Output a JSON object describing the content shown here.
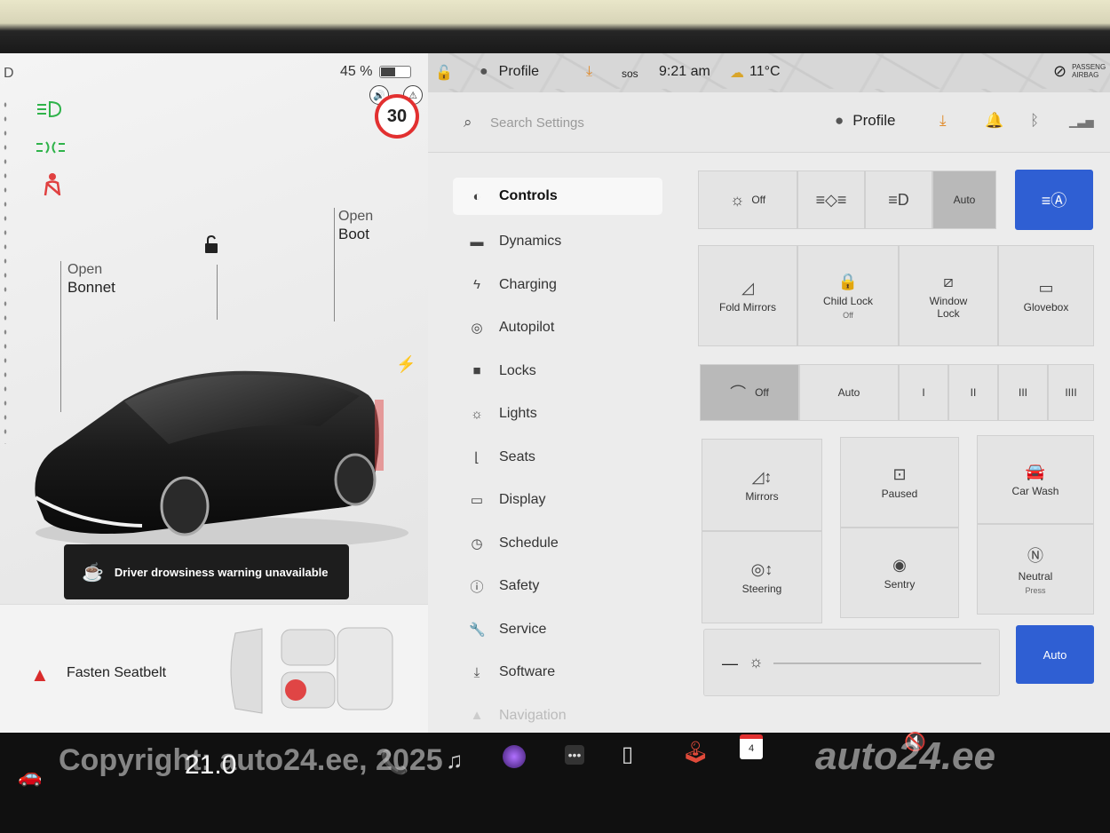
{
  "status": {
    "gear": "D",
    "battery_percent": "45 %",
    "battery_level": 0.45,
    "profile": "Profile",
    "sos": "sos",
    "time": "9:21 am",
    "temperature": "11°C",
    "airbag_line1": "PASSENG",
    "airbag_line2": "AIRBAG"
  },
  "speed_limit": "30",
  "car": {
    "bonnet_action": "Open",
    "bonnet_label": "Bonnet",
    "boot_action": "Open",
    "boot_label": "Boot"
  },
  "toast": {
    "text": "Driver drowsiness warning unavailable"
  },
  "seatbelt": {
    "text": "Fasten Seatbelt"
  },
  "search": {
    "placeholder": "Search Settings"
  },
  "header": {
    "profile": "Profile"
  },
  "nav": {
    "items": [
      {
        "label": "Controls",
        "icon": "toggle-icon"
      },
      {
        "label": "Dynamics",
        "icon": "car-icon"
      },
      {
        "label": "Charging",
        "icon": "bolt-icon"
      },
      {
        "label": "Autopilot",
        "icon": "steering-icon"
      },
      {
        "label": "Locks",
        "icon": "lock-icon"
      },
      {
        "label": "Lights",
        "icon": "sun-icon"
      },
      {
        "label": "Seats",
        "icon": "seat-icon"
      },
      {
        "label": "Display",
        "icon": "display-icon"
      },
      {
        "label": "Schedule",
        "icon": "clock-icon"
      },
      {
        "label": "Safety",
        "icon": "info-icon"
      },
      {
        "label": "Service",
        "icon": "wrench-icon"
      },
      {
        "label": "Software",
        "icon": "download-icon"
      },
      {
        "label": "Navigation",
        "icon": "nav-icon"
      }
    ]
  },
  "controls": {
    "lights": {
      "off": "Off",
      "auto": "Auto"
    },
    "fold_mirrors": "Fold Mirrors",
    "child_lock": "Child Lock",
    "child_lock_state": "Off",
    "window_lock_line1": "Window",
    "window_lock_line2": "Lock",
    "glovebox": "Glovebox",
    "wipers": {
      "off": "Off",
      "auto": "Auto",
      "s1": "I",
      "s2": "II",
      "s3": "III",
      "s4": "IIII"
    },
    "mirrors": "Mirrors",
    "steering": "Steering",
    "dashcam": "Paused",
    "sentry": "Sentry",
    "car_wash": "Car Wash",
    "neutral": "Neutral",
    "neutral_sub": "Press",
    "brightness_auto": "Auto"
  },
  "dock": {
    "temp": "21.0",
    "calendar_day": "4"
  },
  "watermark": {
    "copyright": "Copyright: auto24.ee, 2025",
    "brand": "auto24.ee"
  },
  "colors": {
    "accent_blue": "#2f5fd3",
    "warning_red": "#d92b2b",
    "light_green": "#2fb34a",
    "toast_bg": "#1d1d1d"
  }
}
